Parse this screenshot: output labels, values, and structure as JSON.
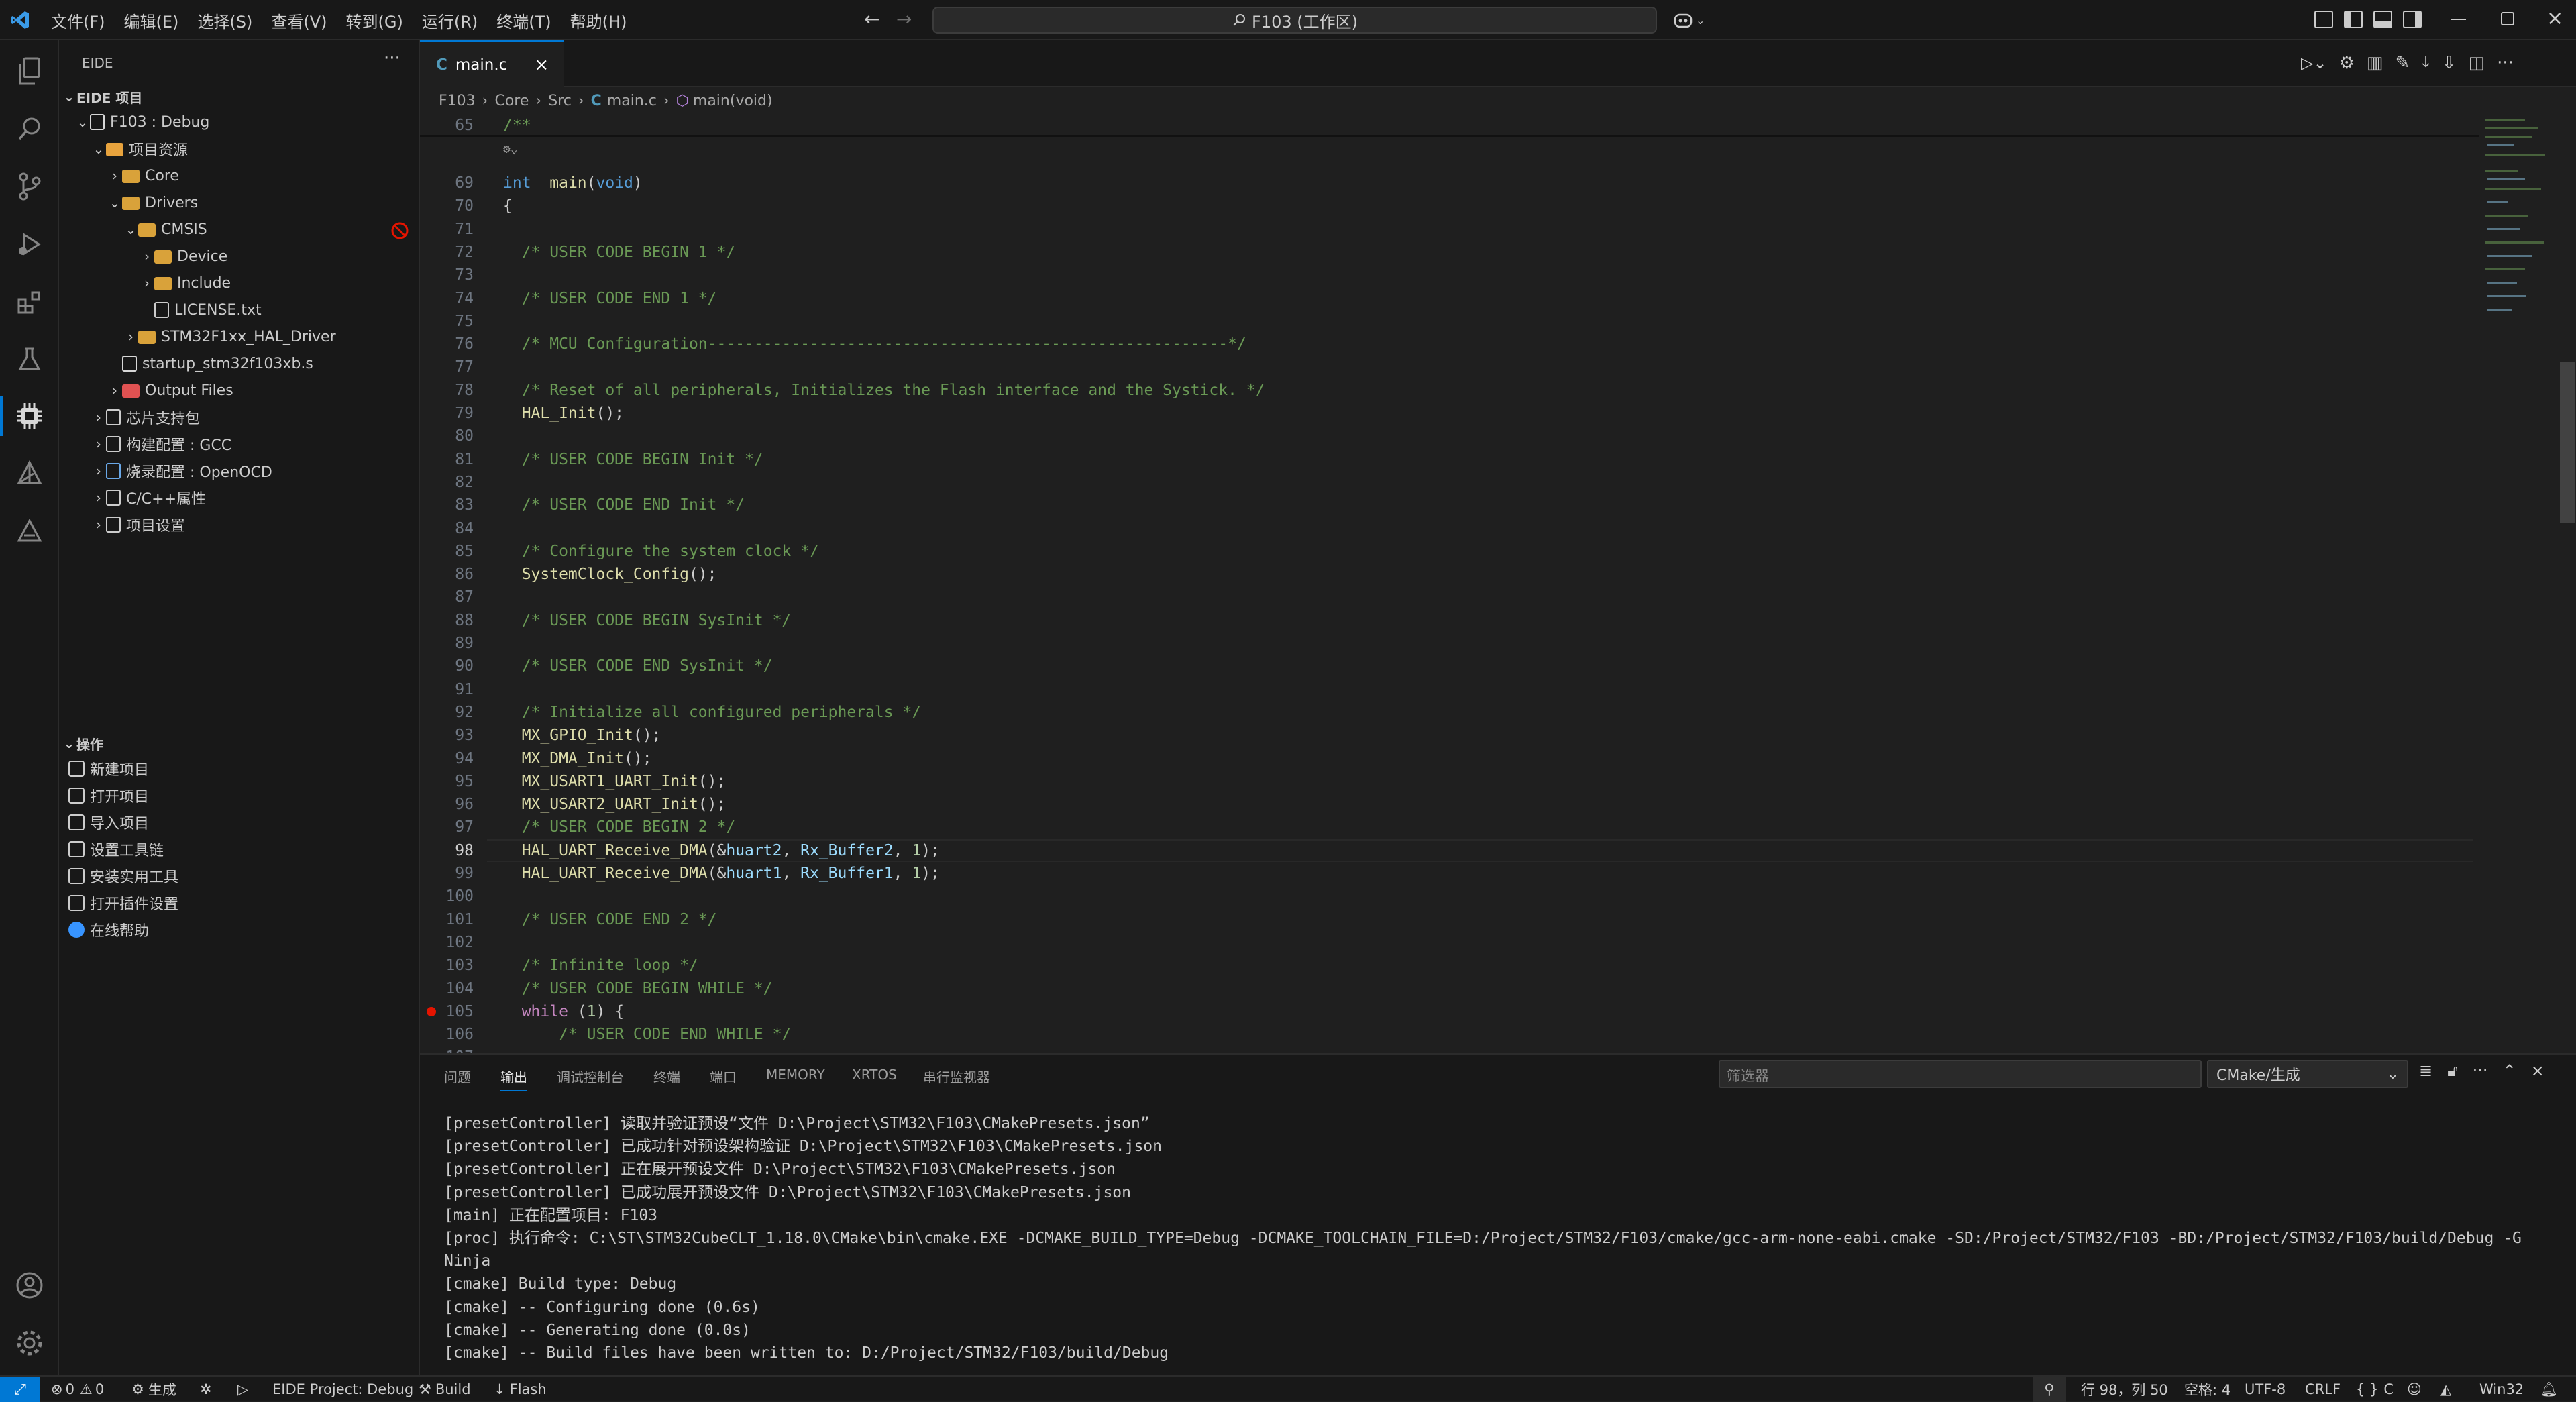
{
  "titlebar": {
    "menu": [
      "文件(F)",
      "编辑(E)",
      "选择(S)",
      "查看(V)",
      "转到(G)",
      "运行(R)",
      "终端(T)",
      "帮助(H)"
    ],
    "command_center": "F103 (工作区)"
  },
  "sidebar": {
    "title": "EIDE",
    "section_project": "EIDE 项目",
    "tree": [
      {
        "label": "F103 : Debug",
        "depth": 1,
        "expanded": true,
        "icon": "project-icon"
      },
      {
        "label": "项目资源",
        "depth": 2,
        "expanded": true,
        "icon": "resource-icon"
      },
      {
        "label": "Core",
        "depth": 3,
        "expanded": false,
        "icon": "folder-icon"
      },
      {
        "label": "Drivers",
        "depth": 3,
        "expanded": true,
        "icon": "folder-icon"
      },
      {
        "label": "CMSIS",
        "depth": 4,
        "expanded": true,
        "icon": "folder-icon"
      },
      {
        "label": "Device",
        "depth": 5,
        "expanded": false,
        "icon": "folder-icon"
      },
      {
        "label": "Include",
        "depth": 5,
        "expanded": false,
        "icon": "folder-icon"
      },
      {
        "label": "LICENSE.txt",
        "depth": 5,
        "leaf": true,
        "icon": "file-icon"
      },
      {
        "label": "STM32F1xx_HAL_Driver",
        "depth": 4,
        "expanded": false,
        "icon": "folder-icon"
      },
      {
        "label": "startup_stm32f103xb.s",
        "depth": 3,
        "leaf": true,
        "icon": "asm-file-icon"
      },
      {
        "label": "Output Files",
        "depth": 3,
        "expanded": false,
        "icon": "output-folder-icon"
      },
      {
        "label": "芯片支持包",
        "depth": 2,
        "expanded": false,
        "icon": "chip-icon"
      },
      {
        "label": "构建配置 : GCC",
        "depth": 2,
        "expanded": false,
        "icon": "build-config-icon"
      },
      {
        "label": "烧录配置 : OpenOCD",
        "depth": 2,
        "expanded": false,
        "icon": "flash-config-icon"
      },
      {
        "label": "C/C++属性",
        "depth": 2,
        "expanded": false,
        "icon": "wrench-icon"
      },
      {
        "label": "项目设置",
        "depth": 2,
        "expanded": false,
        "icon": "gear-icon"
      }
    ],
    "section_ops": "操作",
    "ops": [
      "新建项目",
      "打开项目",
      "导入项目",
      "设置工具链",
      "安装实用工具",
      "打开插件设置",
      "在线帮助"
    ]
  },
  "editor": {
    "tab": "main.c",
    "breadcrumb": [
      "F103",
      "Core",
      "Src",
      "main.c",
      "main(void)"
    ],
    "sticky_line": {
      "num": "65",
      "text": "/**"
    },
    "lines": [
      {
        "num": "69",
        "parts": [
          [
            "kw",
            "int"
          ],
          [
            "",
            "  "
          ],
          [
            "fn",
            "main"
          ],
          [
            "",
            "("
          ],
          [
            "kw",
            "void"
          ],
          [
            "",
            ")"
          ]
        ]
      },
      {
        "num": "70",
        "parts": [
          [
            "",
            "{"
          ]
        ]
      },
      {
        "num": "71",
        "parts": []
      },
      {
        "num": "72",
        "parts": [
          [
            "cm",
            "  /* USER CODE BEGIN 1 */"
          ]
        ]
      },
      {
        "num": "73",
        "parts": []
      },
      {
        "num": "74",
        "parts": [
          [
            "cm",
            "  /* USER CODE END 1 */"
          ]
        ]
      },
      {
        "num": "75",
        "parts": []
      },
      {
        "num": "76",
        "parts": [
          [
            "cm",
            "  /* MCU Configuration--------------------------------------------------------*/"
          ]
        ]
      },
      {
        "num": "77",
        "parts": []
      },
      {
        "num": "78",
        "parts": [
          [
            "cm",
            "  /* Reset of all peripherals, Initializes the Flash interface and the Systick. */"
          ]
        ]
      },
      {
        "num": "79",
        "parts": [
          [
            "fn",
            "  HAL_Init"
          ],
          [
            "",
            "();"
          ]
        ]
      },
      {
        "num": "80",
        "parts": []
      },
      {
        "num": "81",
        "parts": [
          [
            "cm",
            "  /* USER CODE BEGIN Init */"
          ]
        ]
      },
      {
        "num": "82",
        "parts": []
      },
      {
        "num": "83",
        "parts": [
          [
            "cm",
            "  /* USER CODE END Init */"
          ]
        ]
      },
      {
        "num": "84",
        "parts": []
      },
      {
        "num": "85",
        "parts": [
          [
            "cm",
            "  /* Configure the system clock */"
          ]
        ]
      },
      {
        "num": "86",
        "parts": [
          [
            "fn",
            "  SystemClock_Config"
          ],
          [
            "",
            "();"
          ]
        ]
      },
      {
        "num": "87",
        "parts": []
      },
      {
        "num": "88",
        "parts": [
          [
            "cm",
            "  /* USER CODE BEGIN SysInit */"
          ]
        ]
      },
      {
        "num": "89",
        "parts": []
      },
      {
        "num": "90",
        "parts": [
          [
            "cm",
            "  /* USER CODE END SysInit */"
          ]
        ]
      },
      {
        "num": "91",
        "parts": []
      },
      {
        "num": "92",
        "parts": [
          [
            "cm",
            "  /* Initialize all configured peripherals */"
          ]
        ]
      },
      {
        "num": "93",
        "parts": [
          [
            "fn",
            "  MX_GPIO_Init"
          ],
          [
            "",
            "();"
          ]
        ]
      },
      {
        "num": "94",
        "parts": [
          [
            "fn",
            "  MX_DMA_Init"
          ],
          [
            "",
            "();"
          ]
        ]
      },
      {
        "num": "95",
        "parts": [
          [
            "fn",
            "  MX_USART1_UART_Init"
          ],
          [
            "",
            "();"
          ]
        ]
      },
      {
        "num": "96",
        "parts": [
          [
            "fn",
            "  MX_USART2_UART_Init"
          ],
          [
            "",
            "();"
          ]
        ]
      },
      {
        "num": "97",
        "parts": [
          [
            "cm",
            "  /* USER CODE BEGIN 2 */"
          ]
        ]
      },
      {
        "num": "98",
        "parts": [
          [
            "fn",
            "  HAL_UART_Receive_DMA"
          ],
          [
            "",
            "(&"
          ],
          [
            "vr",
            "huart2"
          ],
          [
            "",
            ", "
          ],
          [
            "vr",
            "Rx_Buffer2"
          ],
          [
            "",
            ", "
          ],
          [
            "nm",
            "1"
          ],
          [
            "",
            ");"
          ]
        ]
      },
      {
        "num": "99",
        "parts": [
          [
            "fn",
            "  HAL_UART_Receive_DMA"
          ],
          [
            "",
            "(&"
          ],
          [
            "vr",
            "huart1"
          ],
          [
            "",
            ", "
          ],
          [
            "vr",
            "Rx_Buffer1"
          ],
          [
            "",
            ", "
          ],
          [
            "nm",
            "1"
          ],
          [
            "",
            ");"
          ]
        ]
      },
      {
        "num": "100",
        "parts": []
      },
      {
        "num": "101",
        "parts": [
          [
            "cm",
            "  /* USER CODE END 2 */"
          ]
        ]
      },
      {
        "num": "102",
        "parts": []
      },
      {
        "num": "103",
        "parts": [
          [
            "cm",
            "  /* Infinite loop */"
          ]
        ]
      },
      {
        "num": "104",
        "parts": [
          [
            "cm",
            "  /* USER CODE BEGIN WHILE */"
          ]
        ]
      },
      {
        "num": "105",
        "parts": [
          [
            "pc",
            "  while"
          ],
          [
            "",
            " ("
          ],
          [
            "nm",
            "1"
          ],
          [
            "",
            ") {"
          ]
        ]
      },
      {
        "num": "106",
        "parts": [
          [
            "cm",
            "      /* USER CODE END WHILE */"
          ]
        ]
      },
      {
        "num": "107",
        "parts": []
      }
    ],
    "current_line": "98",
    "breakpoint_line": "105"
  },
  "panel": {
    "tabs": [
      "问题",
      "输出",
      "调试控制台",
      "终端",
      "端口",
      "MEMORY",
      "XRTOS",
      "串行监视器"
    ],
    "active_tab": "输出",
    "filter_placeholder": "筛选器",
    "channel": "CMake/生成",
    "output": [
      "[presetController] 读取并验证预设“文件 D:\\Project\\STM32\\F103\\CMakePresets.json”",
      "[presetController] 已成功针对预设架构验证 D:\\Project\\STM32\\F103\\CMakePresets.json",
      "[presetController] 正在展开预设文件 D:\\Project\\STM32\\F103\\CMakePresets.json",
      "[presetController] 已成功展开预设文件 D:\\Project\\STM32\\F103\\CMakePresets.json",
      "[main] 正在配置项目: F103",
      "[proc] 执行命令: C:\\ST\\STM32CubeCLT_1.18.0\\CMake\\bin\\cmake.EXE -DCMAKE_BUILD_TYPE=Debug -DCMAKE_TOOLCHAIN_FILE=D:/Project/STM32/F103/cmake/gcc-arm-none-eabi.cmake -SD:/Project/STM32/F103 -BD:/Project/STM32/F103/build/Debug -G",
      "Ninja",
      "[cmake] Build type: Debug",
      "[cmake] -- Configuring done (0.6s)",
      "[cmake] -- Generating done (0.0s)",
      "[cmake] -- Build files have been written to: D:/Project/STM32/F103/build/Debug"
    ]
  },
  "statusbar": {
    "errors": "0",
    "warnings": "0",
    "build_label": "生成",
    "eide_project": "EIDE Project: Debug",
    "build": "Build",
    "flash": "Flash",
    "position": "行 98，列 50",
    "spaces": "空格: 4",
    "encoding": "UTF-8",
    "eol": "CRLF",
    "language": "C",
    "platform": "Win32"
  },
  "colors": {
    "accent": "#0078d4",
    "remote": "#0078d4",
    "comment": "#6a9955",
    "keyword": "#569cd6",
    "function": "#dcdcaa",
    "variable": "#9cdcfe",
    "number": "#b5cea8",
    "control": "#c586c0",
    "breakpoint": "#e51400"
  }
}
